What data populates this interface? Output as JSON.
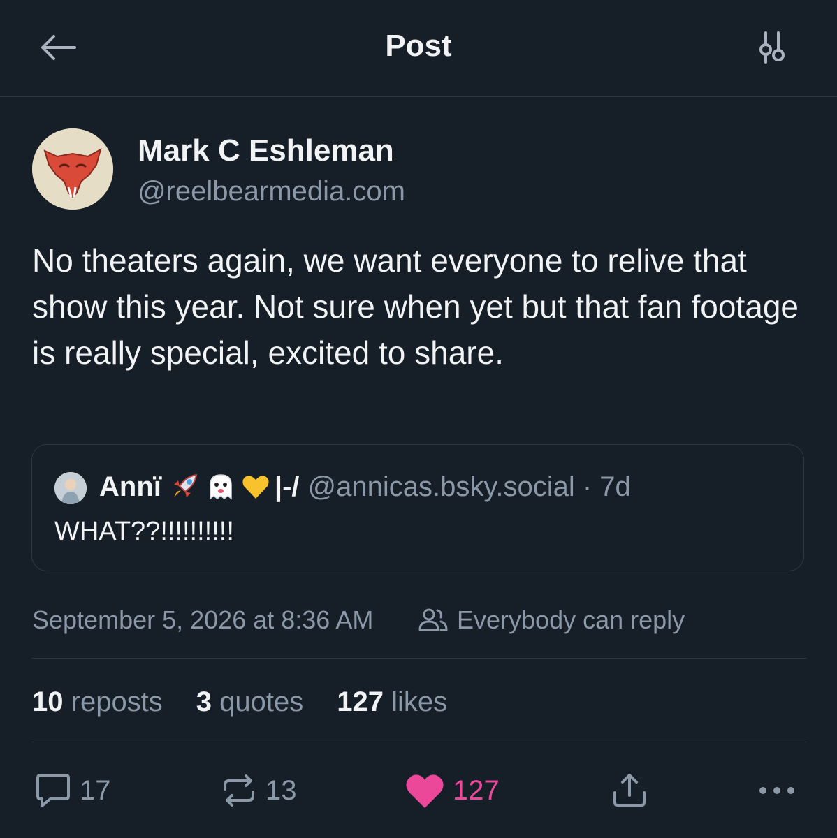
{
  "header": {
    "title": "Post",
    "back_icon": "arrow-left-icon",
    "filter_icon": "sliders-icon"
  },
  "post": {
    "author_name": "Mark C Eshleman",
    "author_handle": "@reelbearmedia.com",
    "text": "No theaters again, we want everyone to relive that show this year. Not sure when yet but that fan footage is really special, excited to share.",
    "quote": {
      "name": "Annï",
      "name_suffix": "|-/",
      "handle_time": "@annicas.bsky.social · 7d",
      "text": "WHAT??!!!!!!!!!!",
      "emoji_icons": [
        "rocket-icon",
        "ghost-icon",
        "yellow-heart-icon"
      ]
    },
    "timestamp": "September 5, 2026 at 8:36 AM",
    "reply_setting": "Everybody can reply"
  },
  "stats": {
    "reposts_count": "10",
    "reposts_label": "reposts",
    "quotes_count": "3",
    "quotes_label": "quotes",
    "likes_count": "127",
    "likes_label": "likes"
  },
  "actions": {
    "reply_count": "17",
    "repost_count": "13",
    "like_count": "127"
  },
  "colors": {
    "background": "#161e27",
    "text": "#f1f3f5",
    "muted": "#8b98a8",
    "border": "#2e3844",
    "like": "#ec4899"
  }
}
